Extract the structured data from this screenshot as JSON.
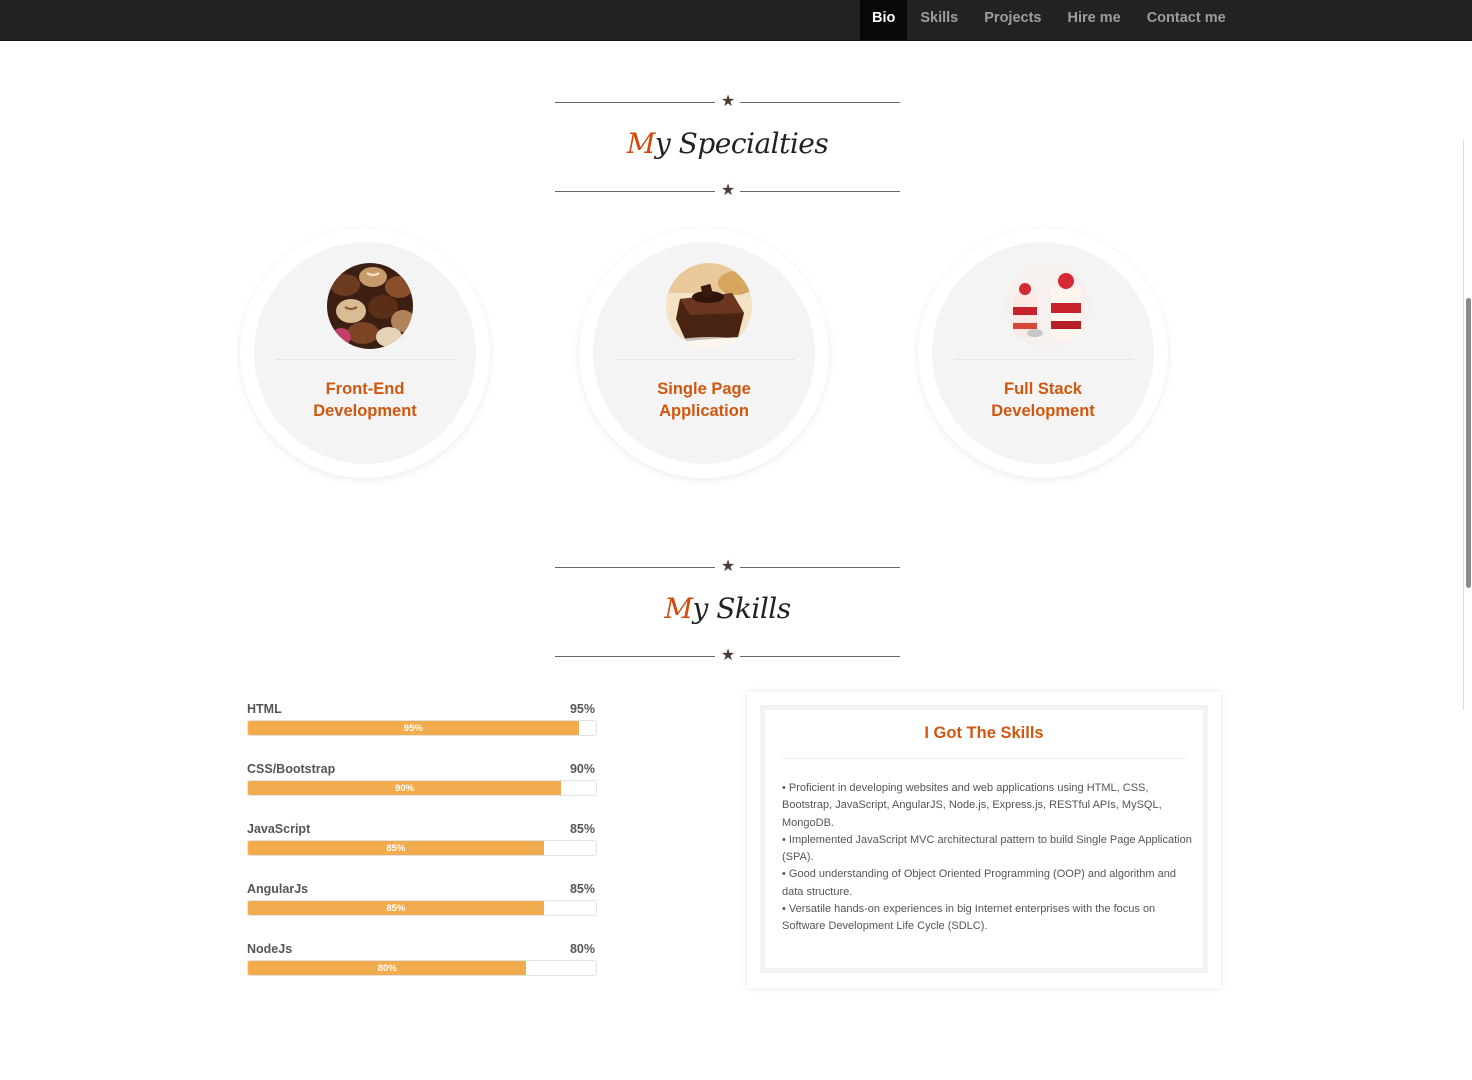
{
  "nav": {
    "items": [
      {
        "label": "Bio",
        "active": true
      },
      {
        "label": "Skills"
      },
      {
        "label": "Projects"
      },
      {
        "label": "Hire me"
      },
      {
        "label": "Contact me"
      }
    ]
  },
  "specialties": {
    "title_first": "M",
    "title_rest": "y Specialties",
    "items": [
      {
        "title": "Front-End\nDevelopment",
        "image": "chocolates-photo"
      },
      {
        "title": "Single Page\nApplication",
        "image": "chocolate-cake-photo"
      },
      {
        "title": "Full Stack\nDevelopment",
        "image": "strawberry-parfait-photo"
      }
    ]
  },
  "skills": {
    "title_first": "M",
    "title_rest": "y Skills",
    "bars": [
      {
        "name": "HTML",
        "percent_text": "95%",
        "value": 95
      },
      {
        "name": "CSS/Bootstrap",
        "percent_text": "90%",
        "value": 90
      },
      {
        "name": "JavaScript",
        "percent_text": "85%",
        "value": 85
      },
      {
        "name": "AngularJs",
        "percent_text": "85%",
        "value": 85
      },
      {
        "name": "NodeJs",
        "percent_text": "80%",
        "value": 80
      }
    ],
    "card": {
      "title": "I Got The Skills",
      "lines": [
        "• Proficient in developing websites and web applications using HTML, CSS, Bootstrap, JavaScript, AngularJS, Node.js, Express.js, RESTful APIs, MySQL, MongoDB.",
        "• Implemented JavaScript MVC architectural pattern to build Single Page Application (SPA).",
        "• Good understanding of Object Oriented Programming (OOP) and algorithm and data structure.",
        "• Versatile hands-on experiences in big Internet enterprises with the focus on Software Development Life Cycle (SDLC)."
      ]
    }
  },
  "colors": {
    "accent": "#d0570f",
    "bar": "#f0ac4e",
    "navbar": "#222222"
  }
}
